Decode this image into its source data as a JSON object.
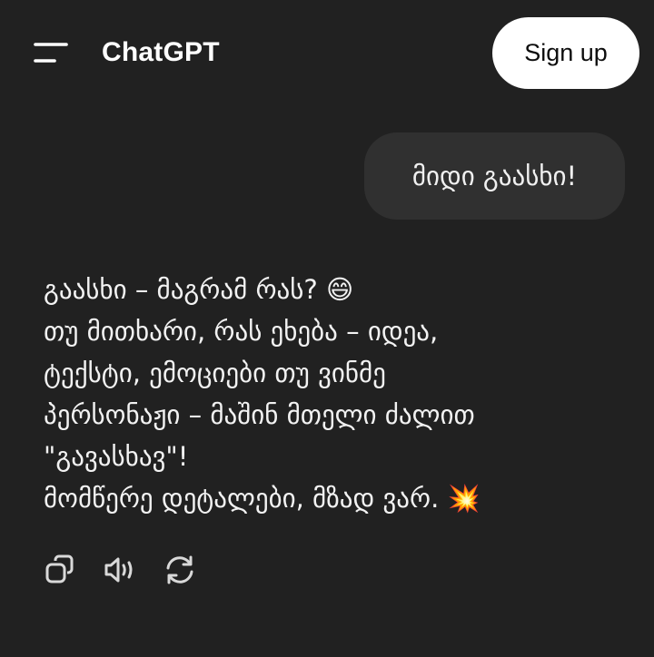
{
  "header": {
    "menu_icon": "menu-icon",
    "title": "ChatGPT",
    "signup_label": "Sign up"
  },
  "conversation": {
    "user_message": "მიდი გაასხი!",
    "assistant_lines": [
      "გაასხი – მაგრამ რას? 😄",
      "თუ მითხარი, რას ეხება – იდეა,",
      "ტექსტი, ემოციები თუ ვინმე",
      "პერსონაჟი – მაშინ მთელი ძალით",
      "\"გავასხავ\"!",
      "მომწერე დეტალები, მზად ვარ. 💥"
    ]
  },
  "actions": {
    "icons": [
      "copy-icon",
      "read-aloud-icon",
      "regenerate-icon"
    ]
  },
  "colors": {
    "background": "#212121",
    "user_bubble": "#303030",
    "signup_bg": "#ffffff",
    "text": "#ececec",
    "icon": "#d9d9d9"
  }
}
